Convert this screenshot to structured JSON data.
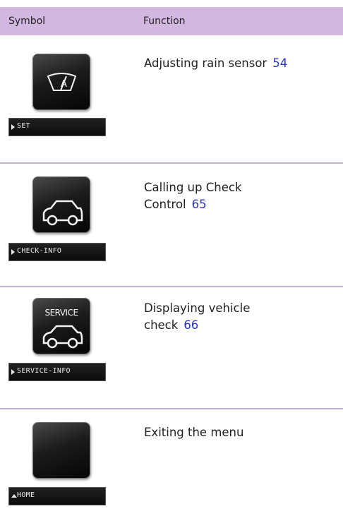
{
  "header": {
    "symbol_label": "Symbol",
    "function_label": "Function"
  },
  "rows": [
    {
      "function_text": "Adjusting rain sensor",
      "page_ref": "54",
      "button_icon": "wiper-a-icon",
      "bar_label": "SET",
      "bar_arrow": "right"
    },
    {
      "function_text": "Calling up Check Control",
      "page_ref": "65",
      "button_icon": "car-icon",
      "bar_label": "CHECK-INFO",
      "bar_arrow": "right"
    },
    {
      "function_text": "Displaying vehicle check",
      "page_ref": "66",
      "button_icon": "car-icon",
      "button_text": "SERVICE",
      "bar_label": "SERVICE-INFO",
      "bar_arrow": "right"
    },
    {
      "function_text": "Exiting the menu",
      "button_icon": "blank-button",
      "bar_label": "HOME",
      "bar_arrow": "up"
    }
  ],
  "colors": {
    "header_bg": "#d2b7e0",
    "divider": "#c7aed7",
    "link": "#2a35c9"
  }
}
